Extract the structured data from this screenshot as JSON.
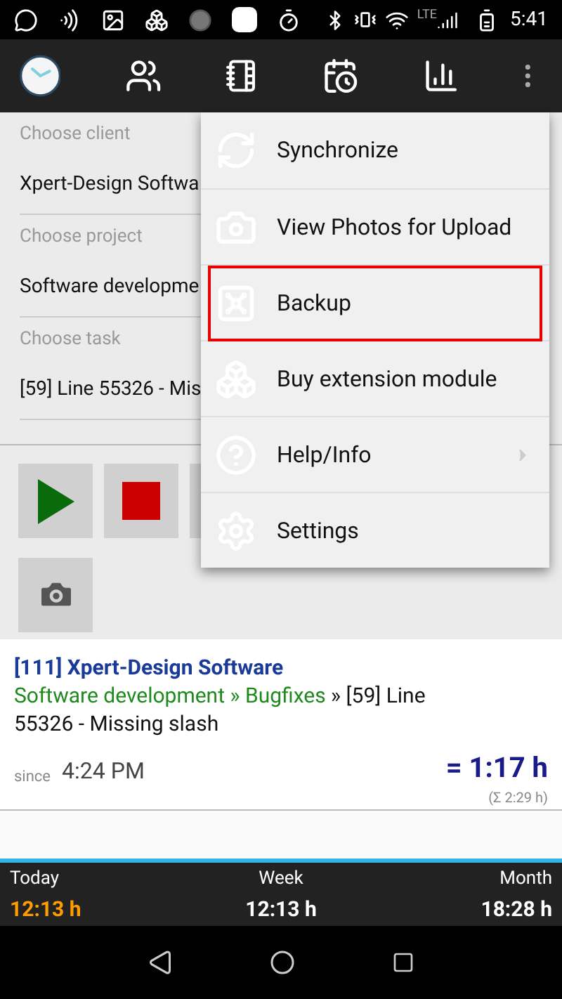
{
  "status_bar": {
    "time": "5:41",
    "network": "LTE"
  },
  "form": {
    "fields": [
      {
        "label": "Choose client",
        "value": "Xpert-Design Softwa"
      },
      {
        "label": "Choose project",
        "value": "Software developme"
      },
      {
        "label": "Choose task",
        "value": "[59] Line 55326 - Mis"
      }
    ]
  },
  "controls": [
    {
      "kind": "play"
    },
    {
      "kind": "stop"
    },
    {
      "kind": "blank"
    },
    {
      "kind": "camera"
    }
  ],
  "menu": {
    "items": [
      {
        "label": "Synchronize",
        "kind": "sync",
        "highlighted": false,
        "has_submenu": false
      },
      {
        "label": "View Photos for Upload",
        "kind": "camera",
        "highlighted": false,
        "has_submenu": false
      },
      {
        "label": "Backup",
        "kind": "safe",
        "highlighted": true,
        "has_submenu": false
      },
      {
        "label": "Buy extension module",
        "kind": "boxes",
        "highlighted": false,
        "has_submenu": false
      },
      {
        "label": "Help/Info",
        "kind": "help",
        "highlighted": false,
        "has_submenu": true
      },
      {
        "label": "Settings",
        "kind": "gear",
        "highlighted": false,
        "has_submenu": false
      }
    ]
  },
  "entry": {
    "client": "[111] Xpert-Design Software",
    "project": "Software development » Bugfixes",
    "task": " » [59] Line 55326 - Missing slash",
    "since_label": "since",
    "since_time": "4:24 PM",
    "duration": "= 1:17 h",
    "total": "(Σ 2:29 h)"
  },
  "totals": [
    {
      "label": "Today",
      "value": "12:13 h",
      "current": true
    },
    {
      "label": "Week",
      "value": "12:13 h",
      "current": false
    },
    {
      "label": "Month",
      "value": "18:28 h",
      "current": false
    }
  ]
}
